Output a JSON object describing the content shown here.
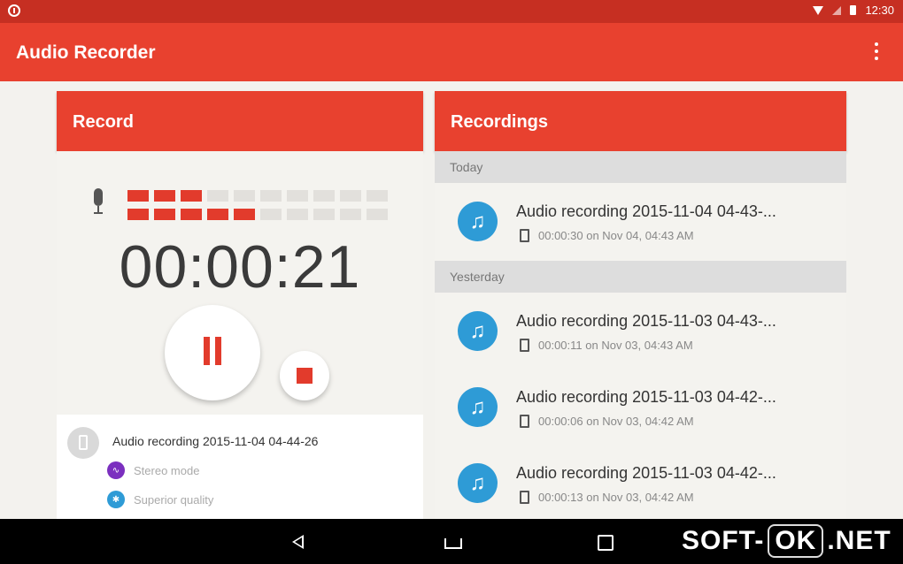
{
  "status_bar": {
    "time": "12:30"
  },
  "app": {
    "title": "Audio Recorder"
  },
  "record_card": {
    "header": "Record",
    "level_meter": {
      "top_lit": 3,
      "bottom_lit": 5,
      "segments": 10
    },
    "timer": "00:00:21",
    "current_file": "Audio recording 2015-11-04 04-44-26",
    "options": [
      {
        "label": "Stereo mode",
        "icon": "stereo-icon",
        "color": "#7b2fbf"
      },
      {
        "label": "Superior quality",
        "icon": "quality-icon",
        "color": "#2e9bd6"
      }
    ]
  },
  "recordings_card": {
    "header": "Recordings",
    "sections": [
      {
        "label": "Today",
        "items": [
          {
            "title": "Audio recording 2015-11-04 04-43-...",
            "meta": "00:00:30 on Nov 04, 04:43 AM"
          }
        ]
      },
      {
        "label": "Yesterday",
        "items": [
          {
            "title": "Audio recording 2015-11-03 04-43-...",
            "meta": "00:00:11 on Nov 03, 04:43 AM"
          },
          {
            "title": "Audio recording 2015-11-03 04-42-...",
            "meta": "00:00:06 on Nov 03, 04:42 AM"
          },
          {
            "title": "Audio recording 2015-11-03 04-42-...",
            "meta": "00:00:13 on Nov 03, 04:42 AM"
          }
        ]
      }
    ]
  },
  "watermark": {
    "left": "SOFT-",
    "boxed": "OK",
    "right": ".NET"
  },
  "colors": {
    "accent": "#e8412f",
    "status_bar": "#c62f22",
    "note_icon": "#2e9bd6",
    "meter_on": "#e23b2c"
  }
}
